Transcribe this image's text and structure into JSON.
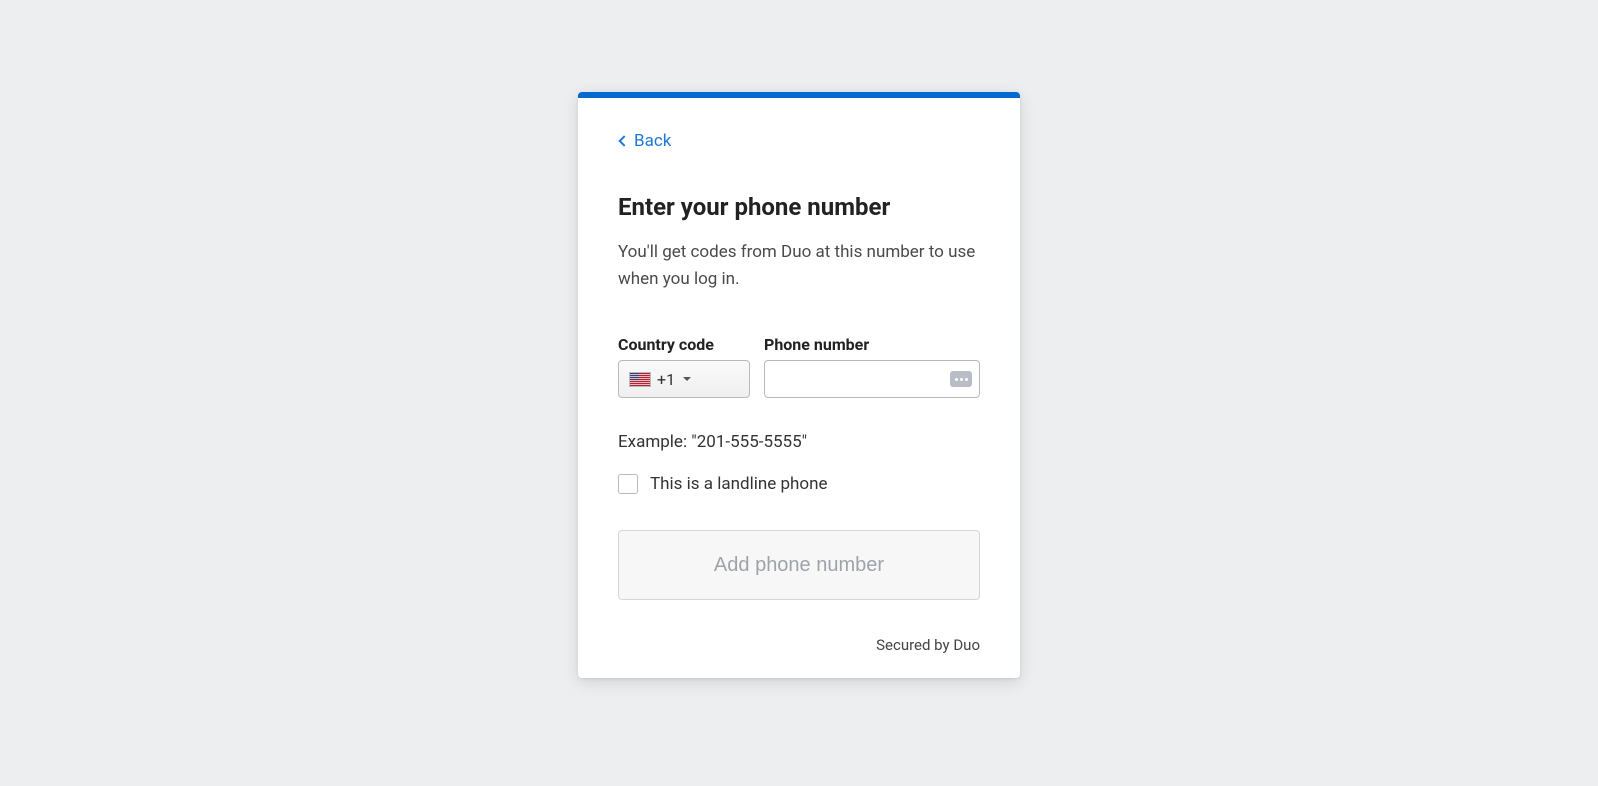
{
  "back_label": "Back",
  "title": "Enter your phone number",
  "subtitle": "You'll get codes from Duo at this number to use when you log in.",
  "country_code": {
    "label": "Country code",
    "value": "+1",
    "flag": "us"
  },
  "phone": {
    "label": "Phone number",
    "value": ""
  },
  "example_text": "Example: \"201-555-5555\"",
  "landline": {
    "label": "This is a landline phone",
    "checked": false
  },
  "submit_label": "Add phone number",
  "footer_text": "Secured by Duo"
}
